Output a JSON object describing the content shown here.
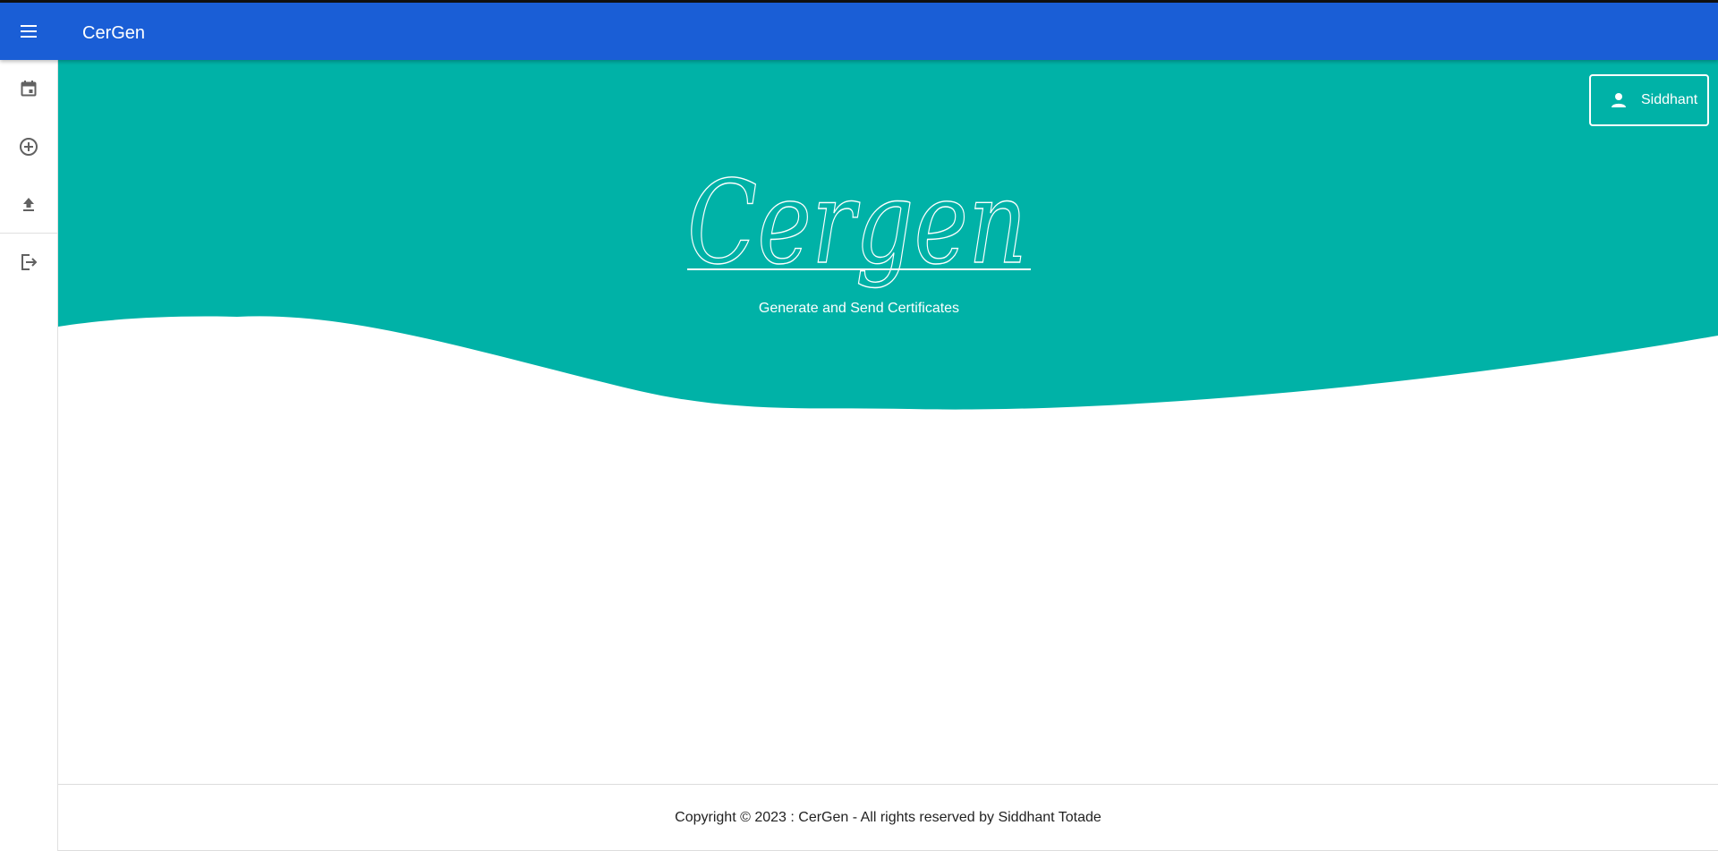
{
  "app": {
    "title": "CerGen",
    "bar_color": "#1a5ed6"
  },
  "sidebar": {
    "items": [
      {
        "icon": "calendar-icon"
      },
      {
        "icon": "add-circle-icon"
      },
      {
        "icon": "upload-icon"
      },
      {
        "icon": "logout-icon"
      }
    ]
  },
  "hero": {
    "background_color": "#00b2a7",
    "logo_text": "Cergen",
    "tagline": "Generate and Send Certificates"
  },
  "user": {
    "name": "Siddhant",
    "icon": "person-icon"
  },
  "footer": {
    "text": "Copyright © 2023 : CerGen - All rights reserved by Siddhant Totade"
  }
}
